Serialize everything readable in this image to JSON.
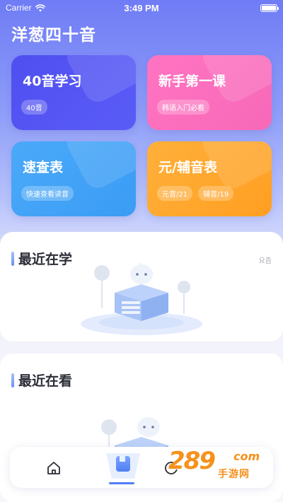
{
  "status_bar": {
    "carrier": "Carrier",
    "time": "3:49 PM"
  },
  "app": {
    "title": "洋葱四十音"
  },
  "cards": [
    {
      "title": "40音学习",
      "tags": [
        "40音"
      ],
      "color": "#5152f2"
    },
    {
      "title": "新手第一课",
      "tags": [
        "韩语入门必看"
      ],
      "color": "#fb70bf"
    },
    {
      "title": "速查表",
      "tags": [
        "快速查看读音"
      ],
      "color": "#43a3f7"
    },
    {
      "title": "元/辅音表",
      "tags": [
        "元音/21",
        "辅音/19"
      ],
      "color": "#ffa72e"
    }
  ],
  "sections": {
    "recent_study": {
      "title": "最近在学",
      "more": "요즘"
    },
    "recent_watch": {
      "title": "最近在看"
    }
  },
  "tabbar": {
    "items": [
      {
        "name": "home",
        "icon": "home-icon"
      },
      {
        "name": "study",
        "icon": "book-icon",
        "active": true
      },
      {
        "name": "profile",
        "icon": "profile-icon"
      }
    ],
    "active_color": "#4f7ef5"
  },
  "watermark": {
    "num": "289",
    "com": "com",
    "sub": "手游网"
  }
}
